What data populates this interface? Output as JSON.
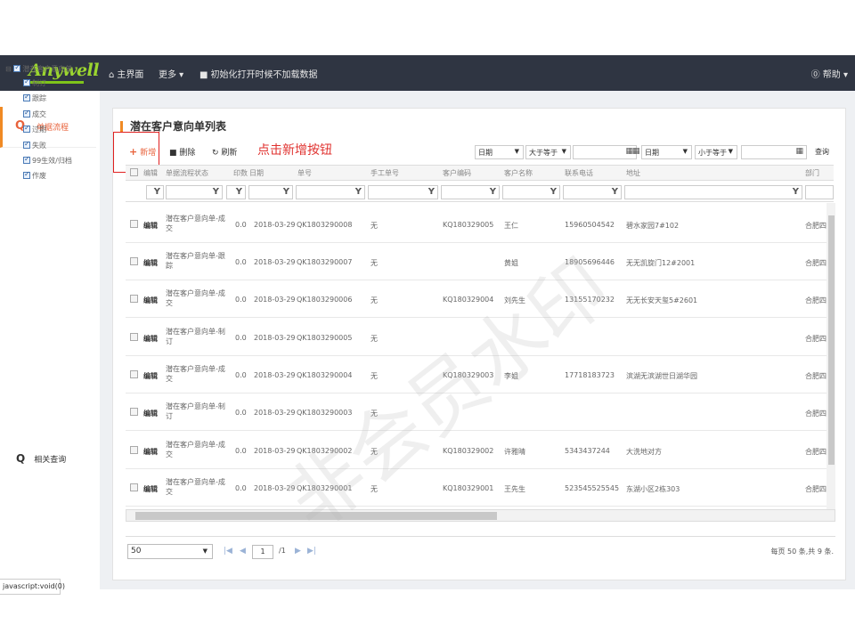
{
  "nav": {
    "logo": "Anywell",
    "home": "主界面",
    "more": "更多",
    "init_option": "初始化打开时候不加载数据",
    "help": "帮助"
  },
  "sidebar": {
    "section_title": "单据流程",
    "tree_root": "潜在客户意向单",
    "tree_items": [
      "制订",
      "跟踪",
      "成交",
      "过期",
      "失败",
      "99生效/归档",
      "作废"
    ],
    "related": "相关查询"
  },
  "status_bar": "javascript:void(0)",
  "page": {
    "title": "潜在客户意向单列表",
    "annotation": "点击新增按钮",
    "toolbar": {
      "add": "新增",
      "delete": "删除",
      "refresh": "刷新"
    },
    "filters": {
      "field1": "日期",
      "op1": "大于等于",
      "field2": "日期",
      "op2": "小于等于",
      "query": "查询"
    },
    "columns": [
      "编辑",
      "单据流程状态",
      "印数",
      "日期",
      "单号",
      "手工单号",
      "客户编码",
      "客户名称",
      "联系电话",
      "地址",
      "部门"
    ],
    "edit_label": "编辑",
    "rows": [
      {
        "status": "潜在客户意向单-成交",
        "print": "0.0",
        "date": "2018-03-29",
        "no": "QK1803290008",
        "manual": "无",
        "code": "KQ180329005",
        "name": "王仁",
        "phone": "15960504542",
        "addr": "碧水家园7#102",
        "dept": "合肥四"
      },
      {
        "status": "潜在客户意向单-跟踪",
        "print": "0.0",
        "date": "2018-03-29",
        "no": "QK1803290007",
        "manual": "无",
        "code": "",
        "name": "黄姐",
        "phone": "18905696446",
        "addr": "无无凯旋门12#2001",
        "dept": "合肥四"
      },
      {
        "status": "潜在客户意向单-成交",
        "print": "0.0",
        "date": "2018-03-29",
        "no": "QK1803290006",
        "manual": "无",
        "code": "KQ180329004",
        "name": "刘先生",
        "phone": "13155170232",
        "addr": "无无长安天玺5#2601",
        "dept": "合肥四"
      },
      {
        "status": "潜在客户意向单-制订",
        "print": "0.0",
        "date": "2018-03-29",
        "no": "QK1803290005",
        "manual": "无",
        "code": "",
        "name": "",
        "phone": "",
        "addr": "",
        "dept": "合肥四"
      },
      {
        "status": "潜在客户意向单-成交",
        "print": "0.0",
        "date": "2018-03-29",
        "no": "QK1803290004",
        "manual": "无",
        "code": "KQ180329003",
        "name": "李姐",
        "phone": "17718183723",
        "addr": "滨湖无滨湖世日湖华园",
        "dept": "合肥四"
      },
      {
        "status": "潜在客户意向单-制订",
        "print": "0.0",
        "date": "2018-03-29",
        "no": "QK1803290003",
        "manual": "无",
        "code": "",
        "name": "",
        "phone": "",
        "addr": "",
        "dept": "合肥四"
      },
      {
        "status": "潜在客户意向单-成交",
        "print": "0.0",
        "date": "2018-03-29",
        "no": "QK1803290002",
        "manual": "无",
        "code": "KQ180329002",
        "name": "许雅晴",
        "phone": "5343437244",
        "addr": "大洗地对方",
        "dept": "合肥四"
      },
      {
        "status": "潜在客户意向单-成交",
        "print": "0.0",
        "date": "2018-03-29",
        "no": "QK1803290001",
        "manual": "无",
        "code": "KQ180329001",
        "name": "王先生",
        "phone": "523545525545",
        "addr": "东湖小区2栋303",
        "dept": "合肥四"
      }
    ],
    "pager": {
      "page_size": "50",
      "current_page": "1",
      "total_pages": "/1",
      "info": "每页 50 条,共 9 条."
    }
  },
  "watermark": "非会员水印",
  "colors": {
    "nav_bg": "#2f3542",
    "accent": "#f08a24",
    "logo_green": "#9bd52f",
    "annotation_red": "#e0322f"
  }
}
